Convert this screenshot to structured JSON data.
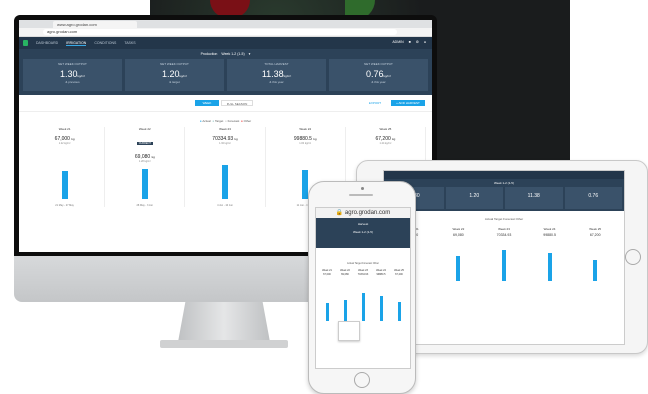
{
  "desktop": {
    "tab_title": "www.agro.grodan.com",
    "url": "agro.grodan.com",
    "nav": [
      "DASHBOARD",
      "IRRIGATION",
      "CONDITIONS",
      "TASKS"
    ],
    "nav_active": 1,
    "nav_right": "ADMIN",
    "production_label": "Production",
    "production_value": "Week 1-2 (1-5)",
    "kpis": [
      {
        "label": "NET WEEK OUTPUT",
        "value": "1.30",
        "unit": "kg/m²",
        "sub": "& previous"
      },
      {
        "label": "NET WEEK OUTPUT",
        "value": "1.20",
        "unit": "kg/m²",
        "sub": "& target"
      },
      {
        "label": "TOTAL HARVEST",
        "value": "11.38",
        "unit": "kg/m²",
        "sub": "& this year"
      },
      {
        "label": "NET WEEK OUTPUT",
        "value": "0.76",
        "unit": "kg/m²",
        "sub": "& this year"
      }
    ],
    "toggle_left": "WEEK",
    "toggle_right": "FULL SEASON",
    "export_label": "EXPORT",
    "add_label": "+ ADD HARVEST",
    "legend": [
      "Actual",
      "Target",
      "Forecast",
      "Other"
    ],
    "weeks": [
      {
        "label": "Week 21",
        "value": "67,000",
        "unit": "kg",
        "sub": "1.22 kg/m²",
        "footer": "21 May - 27 May",
        "badge": ""
      },
      {
        "label": "Week 22",
        "value": "69,080",
        "unit": "kg",
        "sub": "1.28 kg/m²",
        "footer": "28 May - 3 Jun",
        "badge": "CURRENT"
      },
      {
        "label": "Week 23",
        "value": "70334.93",
        "unit": "kg",
        "sub": "1.30 kg/m²",
        "footer": "4 Jun - 10 Jun",
        "badge": ""
      },
      {
        "label": "Week 24",
        "value": "99880.5",
        "unit": "kg",
        "sub": "1.84 kg/m²",
        "footer": "11 Jun - 17 Jun",
        "badge": ""
      },
      {
        "label": "Week 25",
        "value": "67,200",
        "unit": "kg",
        "sub": "1.24 kg/m²",
        "footer": "18 Jun - 24 Jun",
        "badge": ""
      }
    ],
    "bar_levels": [
      0.55,
      0.6,
      0.68,
      0.58,
      0.5
    ]
  },
  "tablet": {
    "production": "Week 1-2 (1-5)",
    "kpis": [
      "1.30",
      "1.20",
      "11.38",
      "0.76"
    ],
    "legend": "Actual  Target  Forecast  Other",
    "weeks": [
      "Week 21",
      "Week 22",
      "Week 23",
      "Week 24",
      "Week 25"
    ],
    "values": [
      "67,000",
      "69,080",
      "70334.93",
      "99880.5",
      "67,200"
    ],
    "bar_levels": [
      0.45,
      0.5,
      0.62,
      0.55,
      0.42
    ]
  },
  "phone": {
    "url": "agro.grodan.com",
    "header_title": "Harvest",
    "production": "Week 1-2 (1-5)",
    "legend": "Actual  Target  Forecast  Other",
    "weeks": [
      "Week 21",
      "Week 22",
      "Week 23",
      "Week 24",
      "Week 25"
    ],
    "values": [
      "67,000",
      "69,080",
      "70334.93",
      "99880.5",
      "67,200"
    ],
    "bar_levels": [
      0.35,
      0.42,
      0.55,
      0.5,
      0.38
    ]
  },
  "colors": {
    "navy": "#23364a",
    "panel": "#2c4258",
    "accent": "#1aa3e8",
    "green": "#28b463"
  }
}
